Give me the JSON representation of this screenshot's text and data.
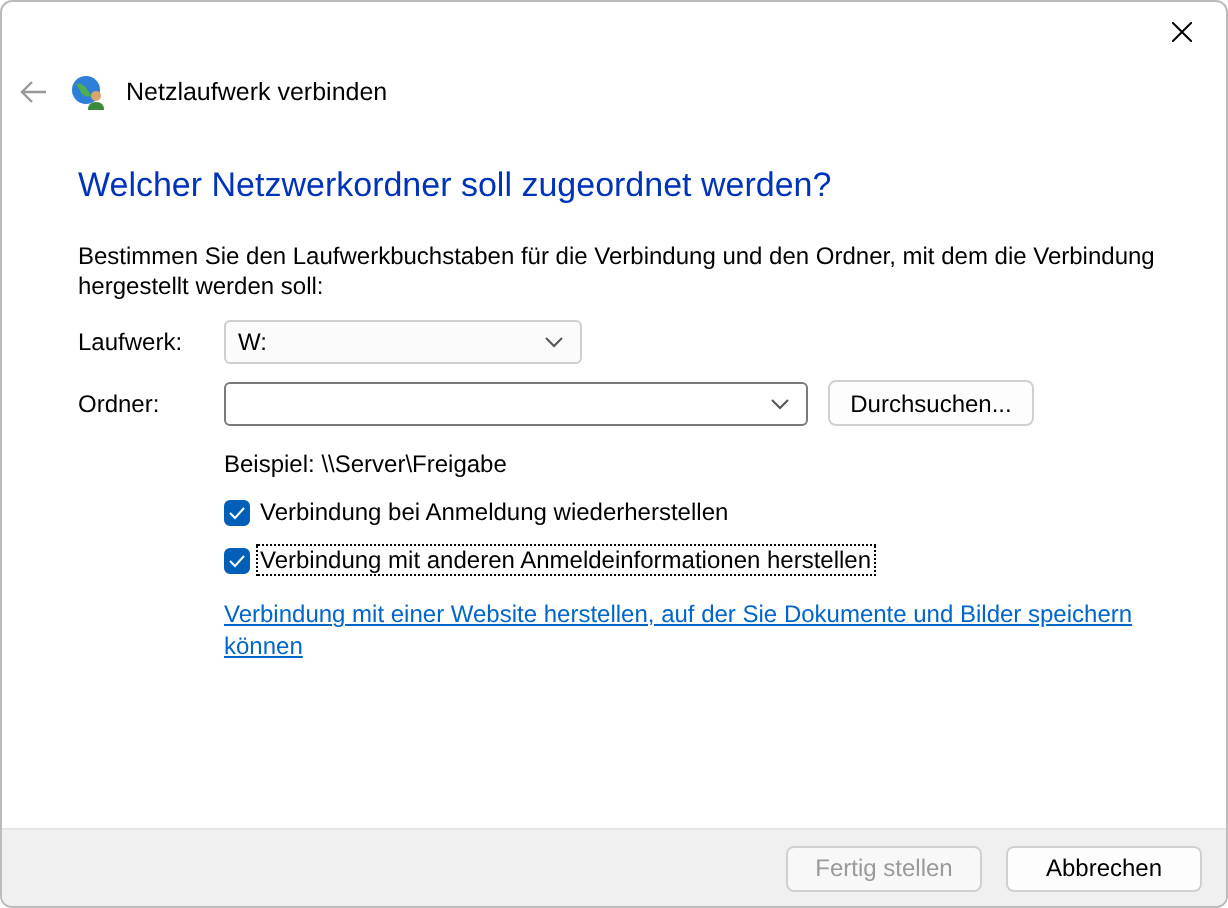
{
  "window": {
    "title": "Netzlaufwerk verbinden"
  },
  "heading": "Welcher Netzwerkordner soll zugeordnet werden?",
  "description": "Bestimmen Sie den Laufwerkbuchstaben für die Verbindung und den Ordner, mit dem die Verbindung hergestellt werden soll:",
  "drive": {
    "label": "Laufwerk:",
    "value": "W:"
  },
  "folder": {
    "label": "Ordner:",
    "browse_button": "Durchsuchen..."
  },
  "example": "Beispiel: \\\\Server\\Freigabe",
  "options": [
    {
      "label": "Verbindung bei Anmeldung wiederherstellen",
      "checked": true,
      "focused": false
    },
    {
      "label": "Verbindung mit anderen Anmeldeinformationen herstellen",
      "checked": true,
      "focused": true
    }
  ],
  "link": "Verbindung mit einer Website herstellen, auf der Sie Dokumente und Bilder speichern können",
  "buttons": [
    {
      "label": "Fertig stellen",
      "disabled": true
    },
    {
      "label": "Abbrechen",
      "disabled": false
    }
  ]
}
